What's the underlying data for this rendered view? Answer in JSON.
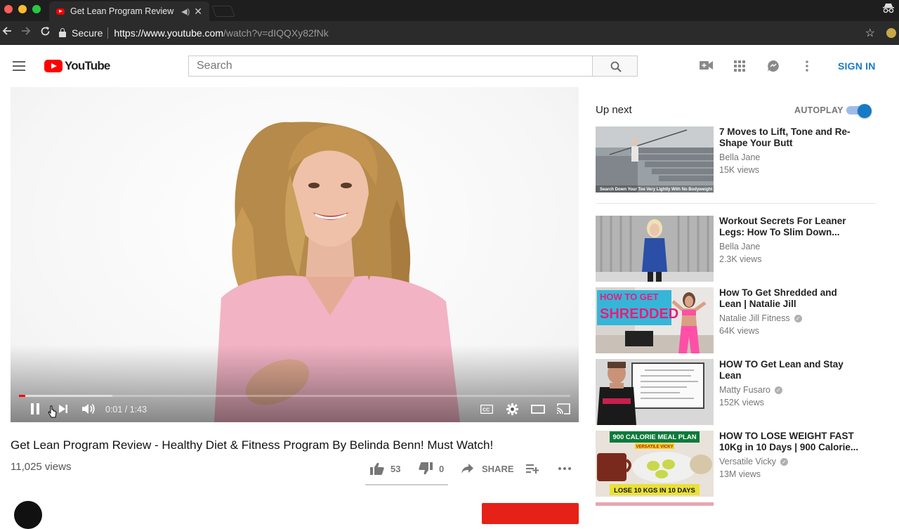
{
  "browser": {
    "tab_title": "Get Lean Program Review",
    "tab_audio_icon": "speaker-icon",
    "secure_label": "Secure",
    "url_host": "https://www.youtube.com",
    "url_path": "/watch?v=dIQQXy82fNk"
  },
  "header": {
    "logo_text": "YouTube",
    "search_placeholder": "Search",
    "signin_label": "SIGN IN",
    "icons": [
      "menu-icon",
      "upload-video-icon",
      "apps-grid-icon",
      "messages-icon",
      "more-vert-icon"
    ]
  },
  "player": {
    "time_display": "0:01 / 1:43",
    "progress_played": 0.012,
    "progress_buffered": 0.17
  },
  "video": {
    "title": "Get Lean Program Review - Healthy Diet & Fitness Program By Belinda Benn! Must Watch!",
    "views": "11,025 views",
    "likes": "53",
    "dislikes": "0",
    "share_label": "SHARE",
    "like_ratio": 1.0
  },
  "sidebar": {
    "up_next_label": "Up next",
    "autoplay_label": "AUTOPLAY",
    "autoplay_on": true,
    "items": [
      {
        "title": "7 Moves to Lift, Tone and Re-Shape Your Butt",
        "channel": "Bella Jane",
        "verified": false,
        "views": "15K views",
        "thumb_caption": "Search Down Your Toe Very Lightly With No Bodyweight"
      },
      {
        "title": "Workout Secrets For Leaner Legs: How To Slim Down...",
        "channel": "Bella Jane",
        "verified": false,
        "views": "2.3K views"
      },
      {
        "title": "How To Get Shredded and Lean | Natalie Jill",
        "channel": "Natalie Jill Fitness",
        "verified": true,
        "views": "64K views",
        "thumb_line1": "HOW TO GET",
        "thumb_line2": "SHREDDED"
      },
      {
        "title": "HOW TO Get Lean and Stay Lean",
        "channel": "Matty Fusaro",
        "verified": true,
        "views": "152K views"
      },
      {
        "title": "HOW TO LOSE WEIGHT FAST 10Kg in 10 Days | 900 Calorie...",
        "channel": "Versatile Vicky",
        "verified": true,
        "views": "13M views",
        "thumb_top": "900 CALORIE MEAL PLAN",
        "thumb_sub": "VERSATILE VICKY",
        "thumb_bottom": "LOSE 10 KGS IN 10 DAYS"
      }
    ]
  },
  "colors": {
    "brand_red": "#ff0000",
    "link_blue": "#167ac6",
    "subscribe_red": "#e62117"
  }
}
